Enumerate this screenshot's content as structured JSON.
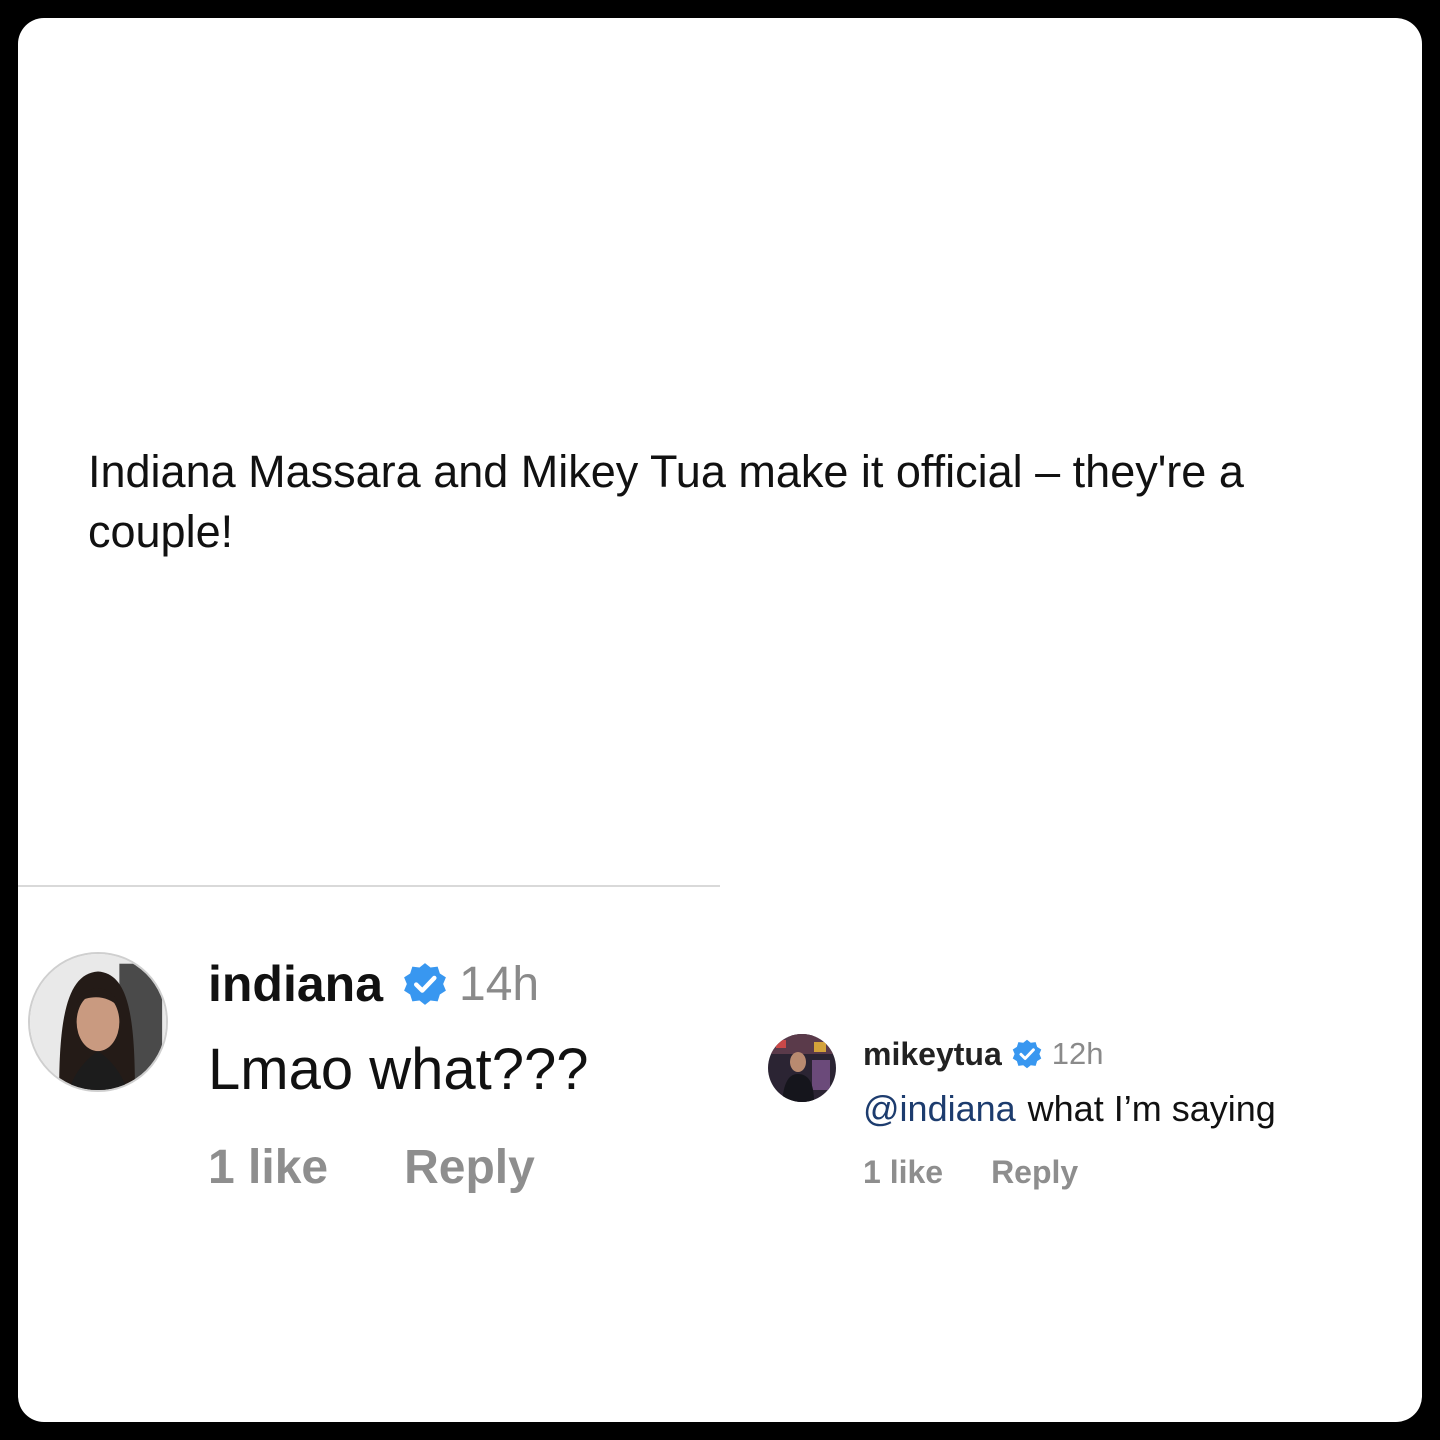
{
  "post": {
    "headline": "Indiana Massara and Mikey Tua make it official – they're a couple!"
  },
  "comments": [
    {
      "username": "indiana",
      "verified": true,
      "time": "14h",
      "text": "Lmao what???",
      "likes": "1 like",
      "reply_label": "Reply"
    },
    {
      "username": "mikeytua",
      "verified": true,
      "time": "12h",
      "mention": "@indiana",
      "text": "what I’m saying",
      "likes": "1 like",
      "reply_label": "Reply"
    }
  ],
  "colors": {
    "verified_badge": "#3897f0",
    "mention": "#1d3c6e",
    "muted": "#8e8e8e",
    "frame": "#000000"
  },
  "icons": {
    "verified": "verified-badge-icon"
  }
}
